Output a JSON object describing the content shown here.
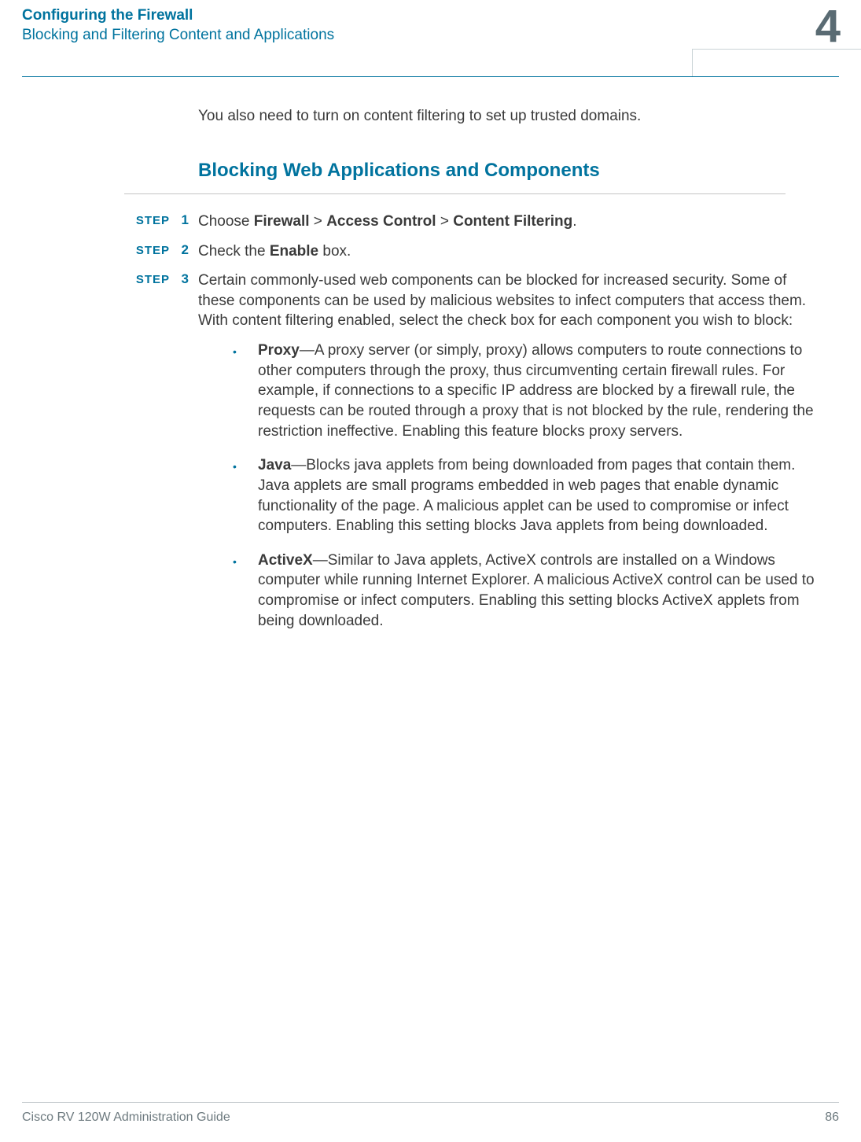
{
  "header": {
    "chapter_title": "Configuring the Firewall",
    "section_subtitle": "Blocking and Filtering Content and Applications",
    "chapter_number": "4"
  },
  "intro": "You also need to turn on content filtering to set up trusted domains.",
  "heading": "Blocking Web Applications and Components",
  "step_label": "STEP",
  "steps": [
    {
      "num": "1",
      "prefix": "Choose ",
      "b1": "Firewall",
      "sep1": " > ",
      "b2": "Access Control",
      "sep2": " > ",
      "b3": "Content Filtering",
      "suffix": "."
    },
    {
      "num": "2",
      "prefix": "Check the ",
      "b1": "Enable",
      "suffix": " box."
    },
    {
      "num": "3",
      "text": "Certain commonly-used web components can be blocked for increased security. Some of these components can be used by malicious websites to infect computers that access them. With content filtering enabled, select the check box for each component you wish to block:"
    }
  ],
  "bullets": [
    {
      "term": "Proxy",
      "desc": "—A proxy server (or simply, proxy) allows computers to route connections to other computers through the proxy, thus circumventing certain firewall rules. For example, if connections to a specific IP address are blocked by a firewall rule, the requests can be routed through a proxy that is not blocked by the rule, rendering the restriction ineffective. Enabling this feature blocks proxy servers."
    },
    {
      "term": "Java",
      "desc": "—Blocks java applets from being downloaded from pages that contain them. Java applets are small programs embedded in web pages that enable dynamic functionality of the page. A malicious applet can be used to compromise or infect computers. Enabling this setting blocks Java applets from being downloaded."
    },
    {
      "term": "ActiveX",
      "desc": "—Similar to Java applets, ActiveX controls are installed on a Windows computer while running Internet Explorer. A malicious ActiveX control can be used to compromise or infect computers. Enabling this setting blocks ActiveX applets from being downloaded."
    }
  ],
  "footer": {
    "book": "Cisco RV 120W Administration Guide",
    "page": "86"
  }
}
